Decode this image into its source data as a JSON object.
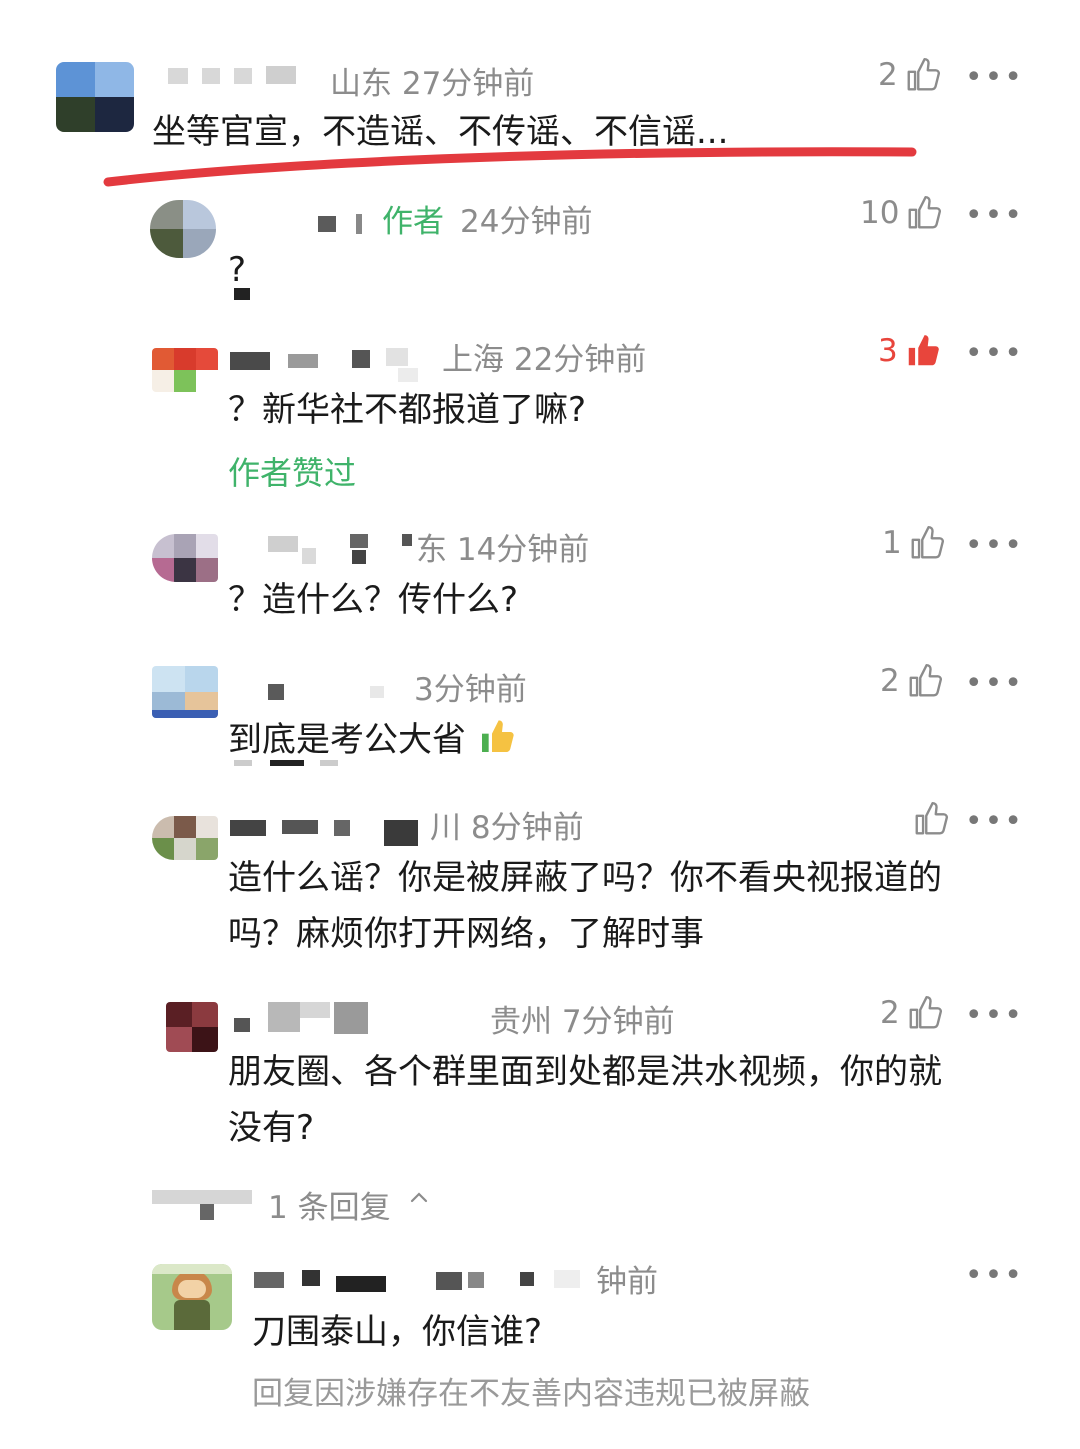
{
  "comments": [
    {
      "location_time": "山东 27分钟前",
      "likes": "2",
      "text": "坐等官宣，不造谣、不传谣、不信谣..."
    },
    {
      "author_tag": "作者",
      "time": "24分钟前",
      "likes": "10",
      "text": "?"
    },
    {
      "location_time": "上海 22分钟前",
      "likes": "3",
      "text": "？新华社不都报道了嘛?",
      "note": "作者赞过"
    },
    {
      "location_time": "东 14分钟前",
      "likes": "1",
      "text": "？造什么？传什么?"
    },
    {
      "location_time": "3分钟前",
      "likes": "2",
      "text": "到底是考公大省"
    },
    {
      "location_time": "川 8分钟前",
      "likes": "",
      "text_line1": "造什么谣？你是被屏蔽了吗？你不看央视报道的",
      "text_line2": "吗？麻烦你打开网络，了解时事"
    },
    {
      "location_time": "贵州 7分钟前",
      "likes": "2",
      "text_line1": "朋友圈、各个群里面到处都是洪水视频，你的就",
      "text_line2": "没有?"
    },
    {
      "location_time": "钟前",
      "text": "刀围泰山，你信谁?",
      "blocked_note": "回复因涉嫌存在不友善内容违规已被屏蔽"
    }
  ],
  "reply_toggle": "1 条回复",
  "colors": {
    "accent_green": "#3fb36a",
    "liked_red": "#e8453c",
    "underline_red": "#e33a3f"
  }
}
